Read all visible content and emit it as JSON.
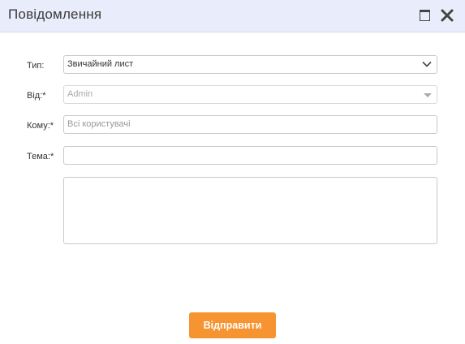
{
  "dialog": {
    "title": "Повідомлення",
    "maximize_icon": "maximize-icon",
    "close_icon": "close-icon"
  },
  "form": {
    "type": {
      "label": "Тип:",
      "value": "Звичайний лист"
    },
    "from": {
      "label": "Від:*",
      "value": "Admin"
    },
    "to": {
      "label": "Кому:*",
      "value": "Всі користувачі"
    },
    "subject": {
      "label": "Тема:*",
      "value": ""
    },
    "body": {
      "value": ""
    }
  },
  "actions": {
    "send_label": "Відправити"
  },
  "colors": {
    "accent": "#f79432",
    "titlebar": "#e9ecfa"
  }
}
